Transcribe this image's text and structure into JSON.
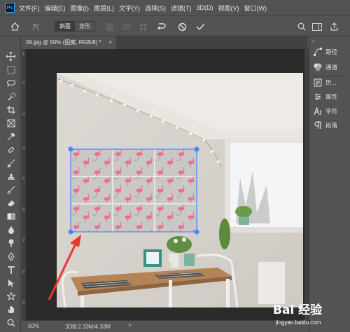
{
  "menubar": {
    "logo": "Ps",
    "items": [
      "文件(F)",
      "编辑(E)",
      "图像(I)",
      "图层(L)",
      "文字(Y)",
      "选择(S)",
      "滤镜(T)",
      "3D(D)",
      "视图(V)",
      "窗口(W)"
    ]
  },
  "options_bar": {
    "mode_buttons": [
      "斜面",
      "变形"
    ],
    "active_mode": "斜面"
  },
  "document": {
    "tab_title": "09.jpg @ 50% (图案, RGB/8) *",
    "close": "×"
  },
  "ruler": {
    "vertical_ticks": [
      "1",
      "2",
      "3",
      "4",
      "5",
      "6",
      "7",
      "8",
      "9"
    ]
  },
  "status": {
    "zoom": "50%",
    "doc_info": "文档:2.33M/4.33M",
    "arrow": ">"
  },
  "panels": {
    "collapse": "«",
    "items": [
      {
        "label": "路径",
        "icon": "paths-icon"
      },
      {
        "label": "通道",
        "icon": "channels-icon"
      },
      {
        "label": "历...",
        "icon": "history-icon"
      },
      {
        "label": "属性",
        "icon": "properties-icon"
      },
      {
        "label": "字符",
        "icon": "character-icon"
      },
      {
        "label": "段落",
        "icon": "paragraph-icon"
      }
    ]
  },
  "watermark": {
    "brand": "Bai 经验",
    "url": "jingyan.baidu.com"
  },
  "colors": {
    "ui_dark": "#535353",
    "canvas_bg": "#2b2b2b",
    "selection_blue": "#4a86ff",
    "annotation_red": "#e8372f",
    "flamingo_pink": "#e8738c"
  }
}
